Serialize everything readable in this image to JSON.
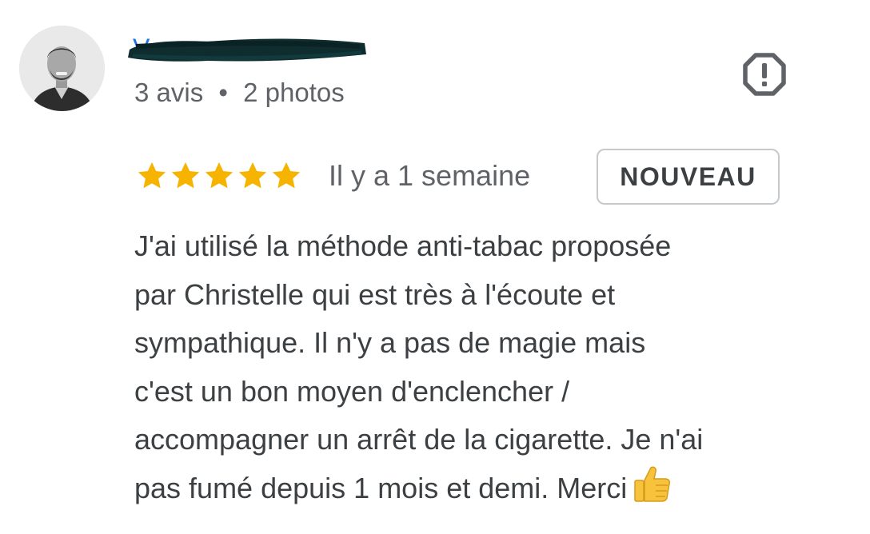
{
  "reviewer": {
    "name": "V",
    "meta_reviews": "3 avis",
    "meta_separator": "•",
    "meta_photos": "2 photos"
  },
  "review": {
    "rating": 5,
    "max_rating": 5,
    "date": "Il y a 1 semaine",
    "badge": "NOUVEAU",
    "text_lines": [
      "J'ai utilisé la méthode anti-tabac proposée",
      "par Christelle qui est très à l'écoute et",
      "sympathique. Il n'y a pas de magie mais",
      "c'est un bon moyen d'enclencher /",
      "accompagner un arrêt de la cigarette. Je n'ai",
      "pas fumé depuis 1 mois et demi. Merci"
    ],
    "emoji": "thumbs-up"
  },
  "icons": {
    "report": "report-octagon-icon",
    "star": "star-icon"
  },
  "colors": {
    "star": "#f6b400",
    "name_link": "#1a73e8",
    "redaction": "#0f2c2e",
    "text": "#3c4043",
    "secondary": "#5f6368",
    "badge_border": "#c6c9cc"
  }
}
